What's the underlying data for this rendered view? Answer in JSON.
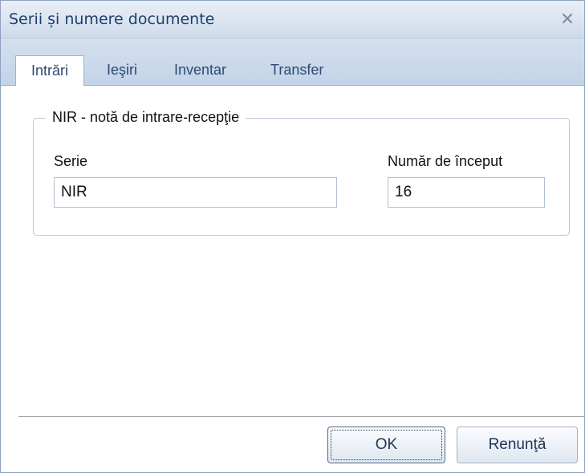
{
  "window": {
    "title": "Serii și numere documente"
  },
  "tabs": [
    {
      "label": "Intrări",
      "active": true
    },
    {
      "label": "Ieşiri",
      "active": false
    },
    {
      "label": "Inventar",
      "active": false
    },
    {
      "label": "Transfer",
      "active": false
    }
  ],
  "group": {
    "legend": "NIR - notă de intrare-recepţie",
    "series_label": "Serie",
    "series_value": "NIR",
    "start_label": "Număr de început",
    "start_value": "16"
  },
  "buttons": {
    "ok": "OK",
    "cancel": "Renunţă"
  },
  "icons": {
    "close": "close-icon"
  },
  "colors": {
    "title_text": "#1f3f6b",
    "tab_text": "#2c4a72",
    "titlebar": "#dce6f2"
  }
}
